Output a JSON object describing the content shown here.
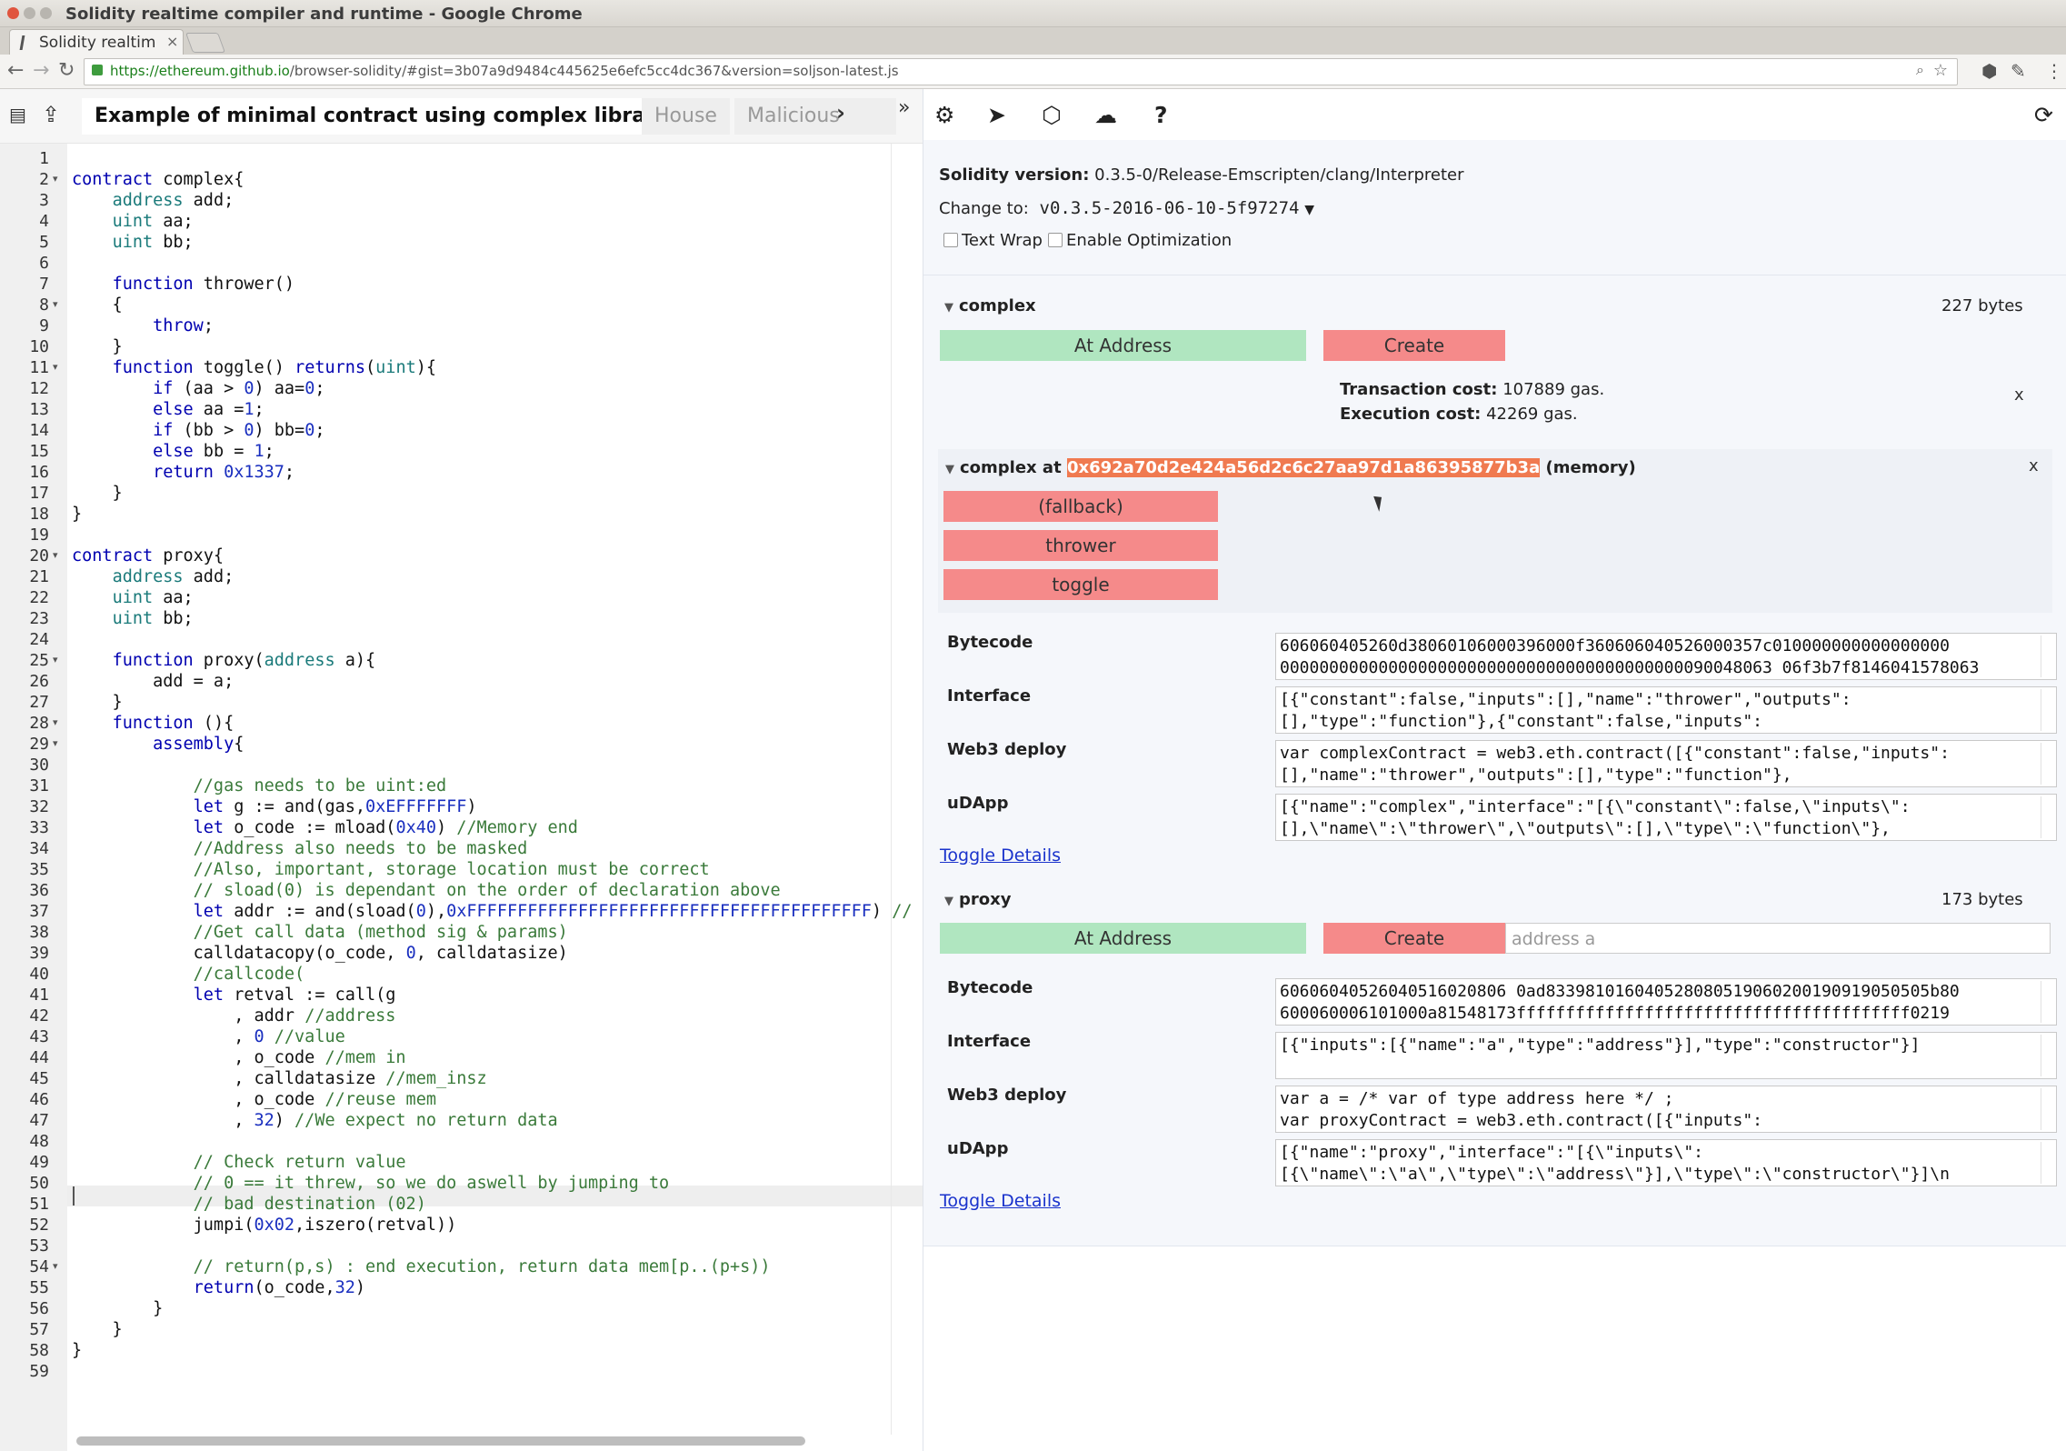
{
  "window": {
    "title": "Solidity realtime compiler and runtime - Google Chrome"
  },
  "browser": {
    "tab_title": "Solidity realtim",
    "url_host": "https://ethereum.github.io",
    "url_rest": "/browser-solidity/#gist=3b07a9d9484c445625e6efc5cc4dc367&version=soljson-latest.js"
  },
  "editor": {
    "file_tabs": [
      {
        "label": "Example of minimal contract using complex library",
        "close": "✖"
      },
      {
        "label": "House"
      },
      {
        "label": "Malicious"
      }
    ],
    "more_tabs": "»",
    "lines": [
      "",
      "contract complex{",
      "    address add;",
      "    uint aa;",
      "    uint bb;",
      "",
      "    function thrower()",
      "    {",
      "        throw;",
      "    }",
      "    function toggle() returns(uint){",
      "        if (aa > 0) aa=0;",
      "        else aa =1;",
      "        if (bb > 0) bb=0;",
      "        else bb = 1;",
      "        return 0x1337;",
      "    }",
      "}",
      "",
      "contract proxy{",
      "    address add;",
      "    uint aa;",
      "    uint bb;",
      "",
      "    function proxy(address a){",
      "        add = a;",
      "    }",
      "    function (){",
      "        assembly{",
      "",
      "            //gas needs to be uint:ed",
      "            let g := and(gas,0xEFFFFFFF)",
      "            let o_code := mload(0x40) //Memory end",
      "            //Address also needs to be masked",
      "            //Also, important, storage location must be correct",
      "            // sload(0) is dependant on the order of declaration above",
      "            let addr := and(sload(0),0xFFFFFFFFFFFFFFFFFFFFFFFFFFFFFFFFFFFFFFFF) //",
      "            //Get call data (method sig & params)",
      "            calldatacopy(o_code, 0, calldatasize)",
      "            //callcode(",
      "            let retval := call(g",
      "                , addr //address",
      "                , 0 //value",
      "                , o_code //mem in",
      "                , calldatasize //mem_insz",
      "                , o_code //reuse mem",
      "                , 32) //We expect no return data",
      "",
      "            // Check return value",
      "            // 0 == it threw, so we do aswell by jumping to",
      "            // bad destination (02)",
      "            jumpi(0x02,iszero(retval))",
      "",
      "            // return(p,s) : end execution, return data mem[p..(p+s))",
      "            return(o_code,32)",
      "        }",
      "    }",
      "}",
      ""
    ]
  },
  "compiler": {
    "version_label": "Solidity version:",
    "version_value": "0.3.5-0/Release-Emscripten/clang/Interpreter",
    "change_label": "Change to:",
    "change_value": "v0.3.5-2016-06-10-5f97274",
    "change_arrow": "▼",
    "text_wrap": "Text Wrap",
    "enable_opt": "Enable Optimization"
  },
  "complex": {
    "name": "complex",
    "bytes": "227 bytes",
    "at_address": "At Address",
    "create": "Create",
    "tx_cost_label": "Transaction cost:",
    "tx_cost_value": "107889 gas.",
    "exec_cost_label": "Execution cost:",
    "exec_cost_value": "42269 gas.",
    "close": "x",
    "instance": {
      "prefix": "complex at",
      "address": "0x692a70d2e424a56d2c6c27aa97d1a86395877b3a",
      "suffix": "(memory)",
      "close": "x",
      "functions": [
        "(fallback)",
        "thrower",
        "toggle"
      ]
    },
    "bytecode_label": "Bytecode",
    "bytecode": "606060405260d38060106000396000f360606040526000357c010000000000000000\n00000000000000000000000000000000000000000090048063 06f3b7f8146041578063",
    "interface_label": "Interface",
    "interface": "[{\"constant\":false,\"inputs\":[],\"name\":\"thrower\",\"outputs\":\n[],\"type\":\"function\"},{\"constant\":false,\"inputs\":",
    "web3_label": "Web3 deploy",
    "web3": "var complexContract = web3.eth.contract([{\"constant\":false,\"inputs\":\n[],\"name\":\"thrower\",\"outputs\":[],\"type\":\"function\"},",
    "udapp_label": "uDApp",
    "udapp": "[{\"name\":\"complex\",\"interface\":\"[{\\\"constant\\\":false,\\\"inputs\\\":\n[],\\\"name\\\":\\\"thrower\\\",\\\"outputs\\\":[],\\\"type\\\":\\\"function\\\"},",
    "toggle_details": "Toggle Details"
  },
  "proxy": {
    "name": "proxy",
    "bytes": "173 bytes",
    "at_address": "At Address",
    "create": "Create",
    "address_placeholder": "address a",
    "bytecode_label": "Bytecode",
    "bytecode": "60606040526040516020806 0ad833981016040528080519060200190919050505b80\n600060006101000a81548173ffffffffffffffffffffffffffffffffffffffff0219",
    "interface_label": "Interface",
    "interface": "[{\"inputs\":[{\"name\":\"a\",\"type\":\"address\"}],\"type\":\"constructor\"}]",
    "web3_label": "Web3 deploy",
    "web3": "var a = /* var of type address here */ ;\nvar proxyContract = web3.eth.contract([{\"inputs\":",
    "udapp_label": "uDApp",
    "udapp": "[{\"name\":\"proxy\",\"interface\":\"[{\\\"inputs\\\":\n[{\\\"name\\\":\\\"a\\\",\\\"type\\\":\\\"address\\\"}],\\\"type\\\":\\\"constructor\\\"}]\\n",
    "toggle_details": "Toggle Details"
  },
  "icons": {
    "left_header": [
      "files-icon",
      "upload-icon"
    ],
    "right_toolbar": [
      "gear-icon",
      "send-icon",
      "cube-icon",
      "cloud-upload-icon",
      "help-icon",
      "sync-icon"
    ]
  }
}
